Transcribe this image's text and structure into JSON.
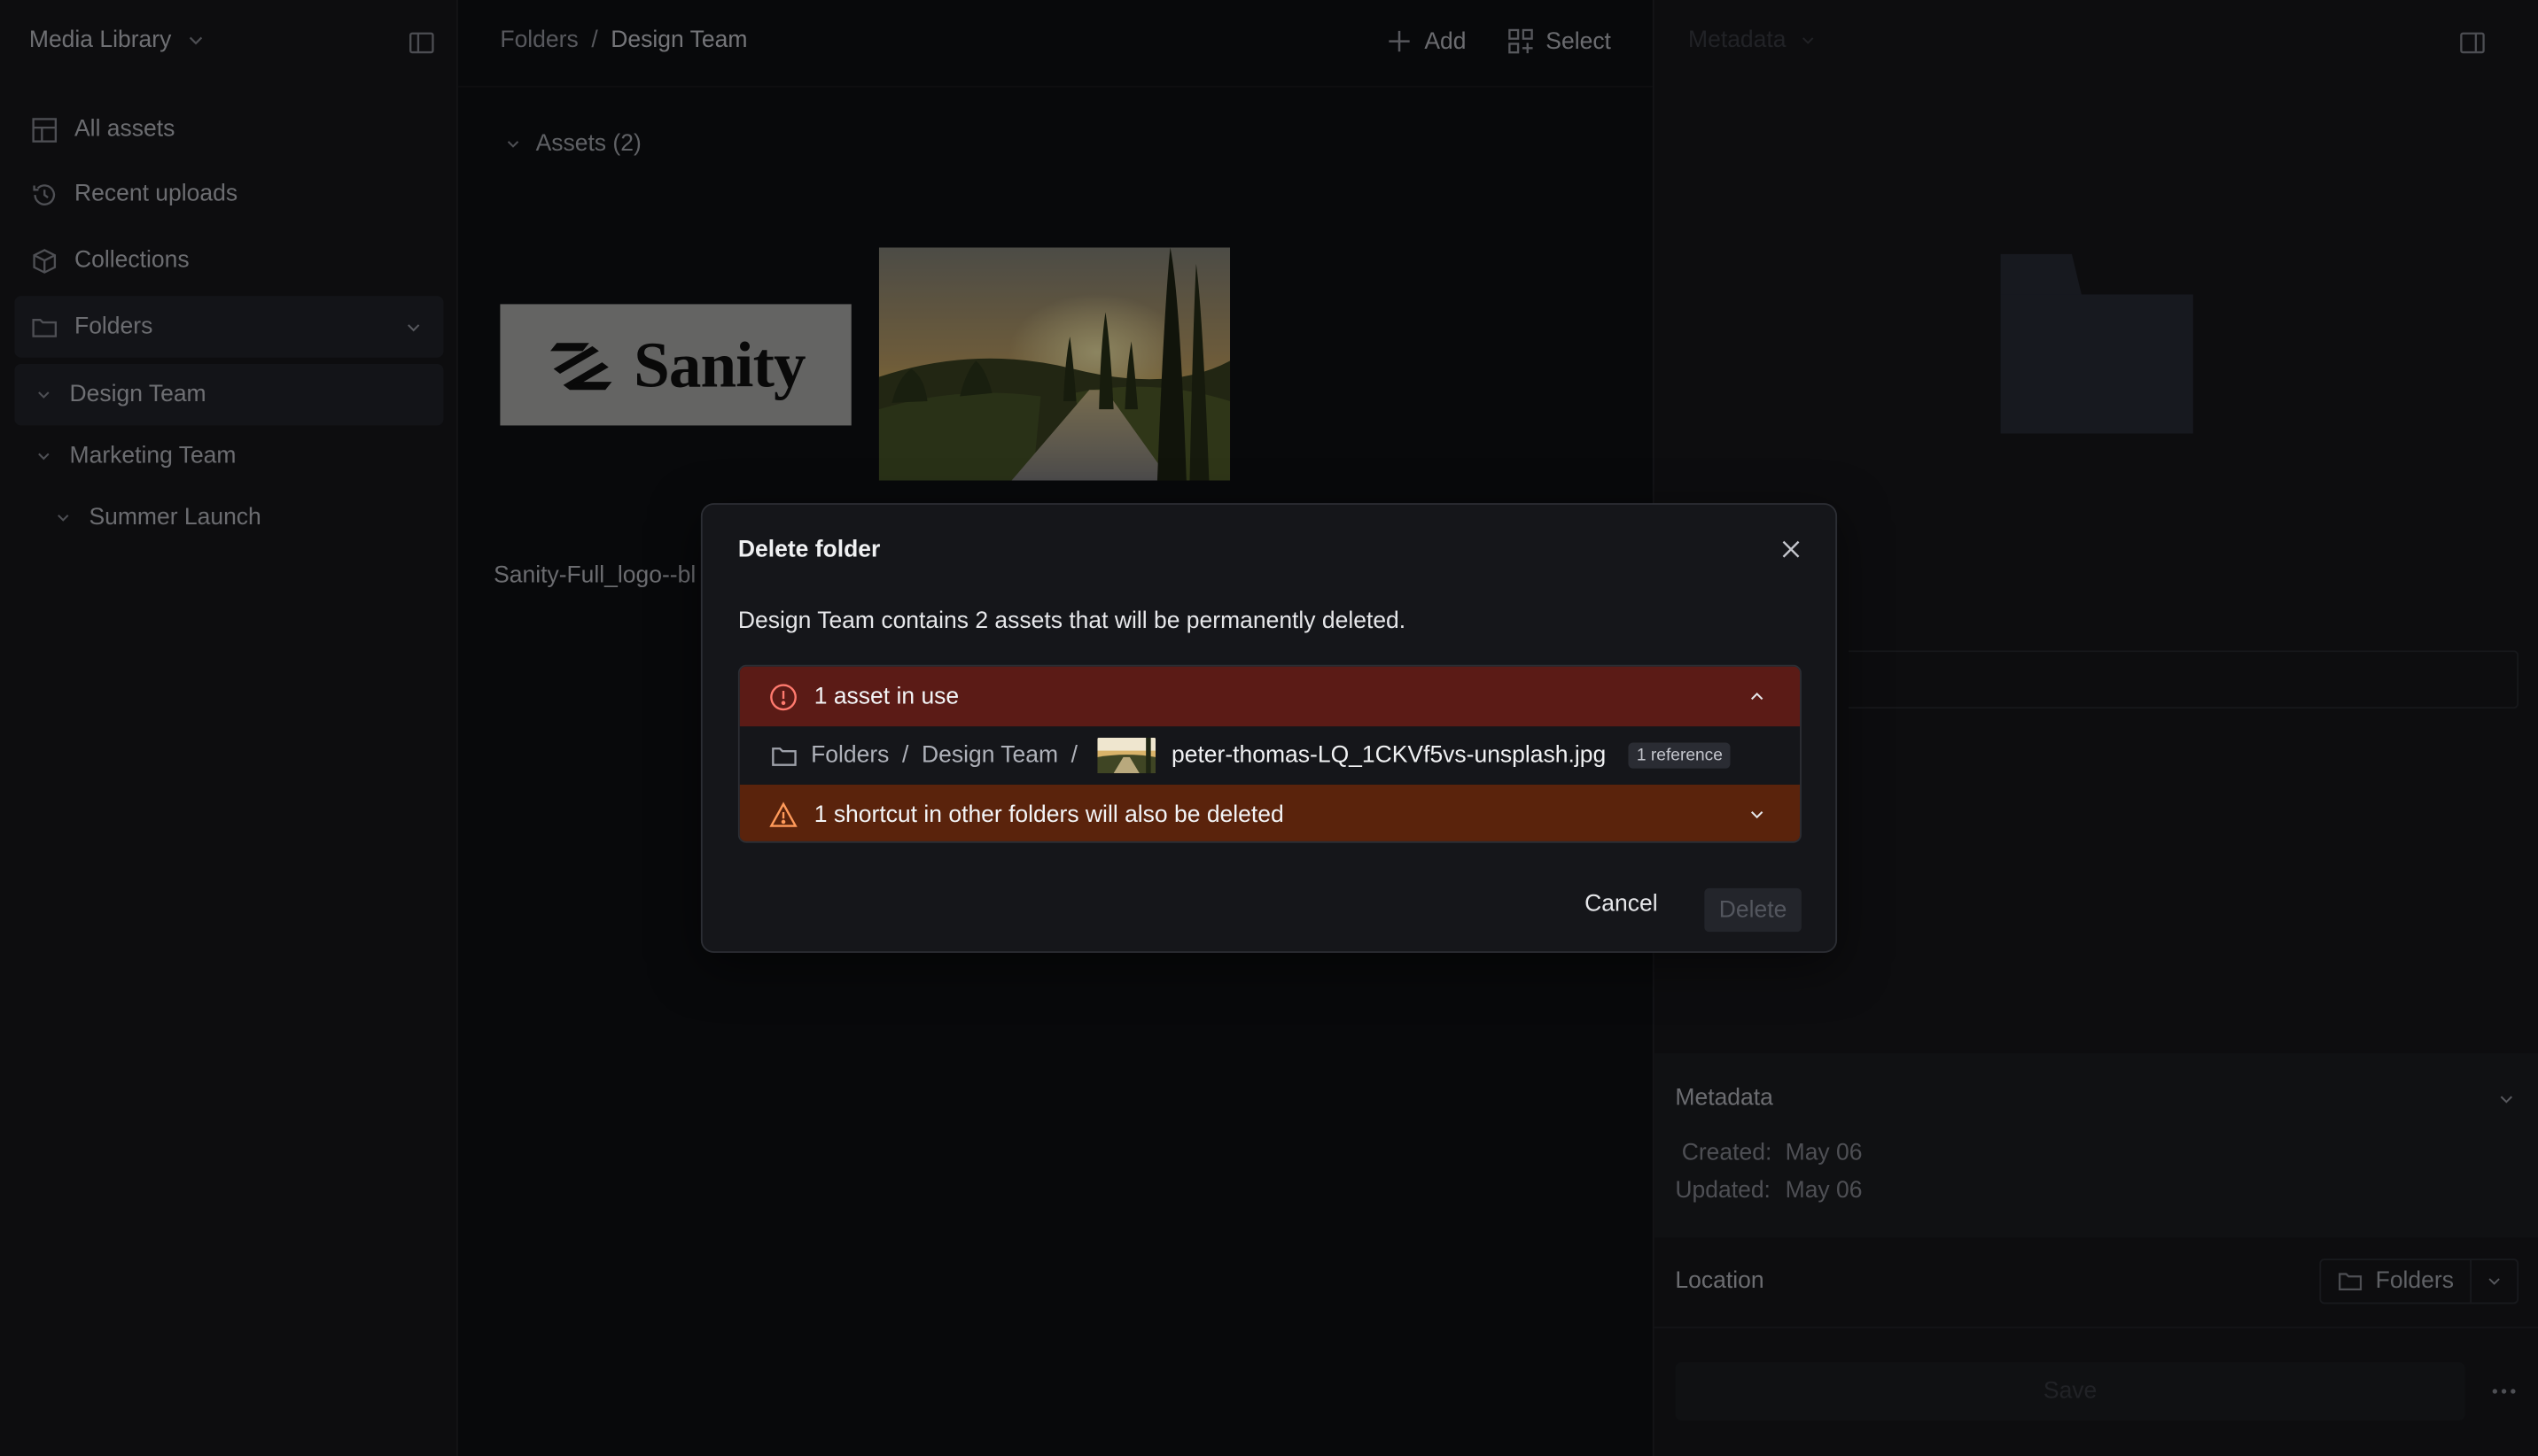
{
  "sidebar": {
    "library_title": "Media Library",
    "nav": [
      {
        "label": "All assets",
        "icon": "grid-icon"
      },
      {
        "label": "Recent uploads",
        "icon": "history-icon"
      },
      {
        "label": "Collections",
        "icon": "box-icon"
      },
      {
        "label": "Folders",
        "icon": "folder-icon"
      }
    ],
    "tree": [
      {
        "label": "Design Team",
        "active": true
      },
      {
        "label": "Marketing Team"
      },
      {
        "label": "Summer Launch"
      }
    ]
  },
  "main": {
    "breadcrumb": [
      "Folders",
      "/",
      "Design Team"
    ],
    "add_label": "Add",
    "select_label": "Select",
    "assets_heading": "Assets (2)",
    "logo_text": "Sanity",
    "asset_name": "Sanity-Full_logo--bl"
  },
  "right": {
    "metadata_top_label": "Metadata",
    "metadata_label": "Metadata",
    "created_label": "Created:",
    "created_value": "May 06",
    "updated_label": "Updated:",
    "updated_value": "May 06",
    "location_label": "Location",
    "location_value": "Folders",
    "save_label": "Save"
  },
  "dialog": {
    "title": "Delete folder",
    "message": "Design Team contains 2 assets that will be permanently deleted.",
    "in_use_label": "1 asset in use",
    "ref_path": [
      "Folders",
      "/",
      "Design Team",
      "/"
    ],
    "ref_file": "peter-thomas-LQ_1CKVf5vs-unsplash.jpg",
    "ref_badge": "1 reference",
    "shortcut_label": "1 shortcut in other folders will also be deleted",
    "cancel_label": "Cancel",
    "delete_label": "Delete"
  },
  "colors": {
    "error_bg": "#5b1b16",
    "warning_bg": "#5a230c",
    "background": "#101114",
    "panel": "#18191d"
  }
}
